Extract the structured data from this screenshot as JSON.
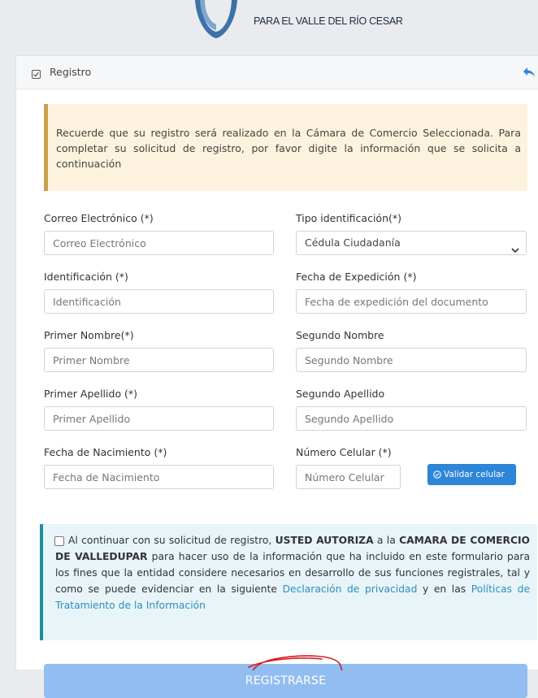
{
  "header": {
    "logo_text": "PARA EL VALLE DEL RÍO CESAR"
  },
  "card": {
    "title": "Registro"
  },
  "notice": {
    "text": "Recuerde que su registro será realizado en la Cámara de Comercio Seleccionada. Para completar su solicitud de registro, por favor digite la información que se solicita a continuación"
  },
  "form": {
    "correo": {
      "label": "Correo Electrónico (*)",
      "placeholder": "Correo Electrónico"
    },
    "tipo_id": {
      "label": "Tipo identificación(*)",
      "value": "Cédula Ciudadanía"
    },
    "identificacion": {
      "label": "Identificación (*)",
      "placeholder": "Identificación"
    },
    "fecha_expedicion": {
      "label": "Fecha de Expedición (*)",
      "placeholder": "Fecha de expedición del documento"
    },
    "primer_nombre": {
      "label": "Primer Nombre(*)",
      "placeholder": "Primer Nombre"
    },
    "segundo_nombre": {
      "label": "Segundo Nombre",
      "placeholder": "Segundo Nombre"
    },
    "primer_apellido": {
      "label": "Primer Apellido (*)",
      "placeholder": "Primer Apellido"
    },
    "segundo_apellido": {
      "label": "Segundo Apellido",
      "placeholder": "Segundo Apellido"
    },
    "fecha_nacimiento": {
      "label": "Fecha de Nacimiento (*)",
      "placeholder": "Fecha de Nacimiento"
    },
    "celular": {
      "label": "Número Celular (*)",
      "placeholder": "Número Celular"
    },
    "validar_label": "Validar celular"
  },
  "consent": {
    "t1": "Al continuar con su solicitud de registro, ",
    "b1": "USTED AUTORIZA",
    "t2": " a la ",
    "b2": "CAMARA DE COMERCIO DE VALLEDUPAR",
    "t3": " para hacer uso de la información que ha incluido en este formulario para los fines que la entidad considere necesarios en desarrollo de sus funciones registrales, tal y como se puede evidenciar en la siguiente ",
    "link1": "Declaración de privacidad",
    "t4": " y en las ",
    "link2": "Políticas de Tratamiento de la Información"
  },
  "submit_label": "REGISTRARSE",
  "colors": {
    "primary": "#2d86d9",
    "submit": "#92bdf1",
    "warning_bg": "#fdf2dd",
    "info_bg": "#e8f4f8",
    "annotation": "#d7191c"
  }
}
